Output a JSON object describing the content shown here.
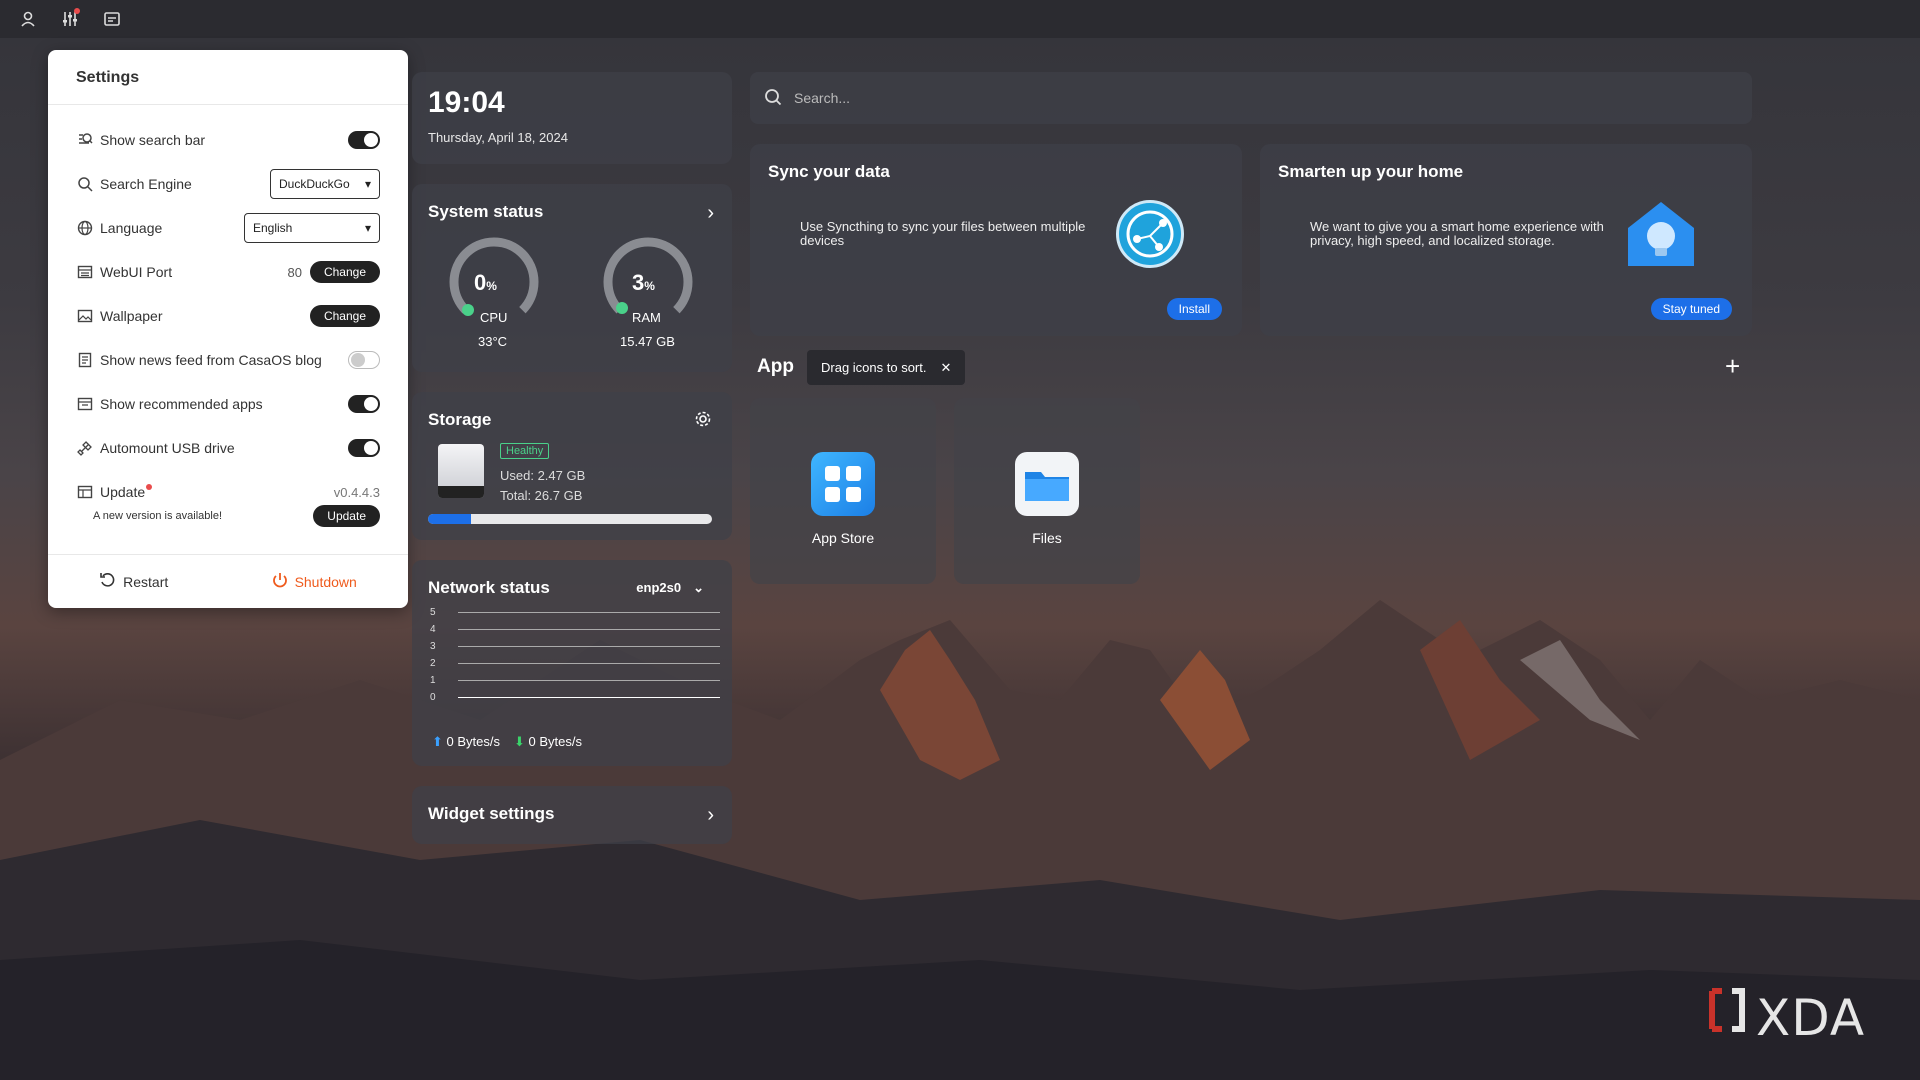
{
  "topbar": {
    "icons": [
      "user-icon",
      "sliders-icon",
      "widget-icon"
    ],
    "notification_dot_color": "#e94c4c"
  },
  "settings": {
    "title": "Settings",
    "show_search_bar": {
      "label": "Show search bar",
      "on": true
    },
    "search_engine": {
      "label": "Search Engine",
      "value": "DuckDuckGo"
    },
    "language": {
      "label": "Language",
      "value": "English"
    },
    "webui_port": {
      "label": "WebUI Port",
      "value": "80",
      "button": "Change"
    },
    "wallpaper": {
      "label": "Wallpaper",
      "button": "Change"
    },
    "news_feed": {
      "label": "Show news feed from CasaOS blog",
      "on": false
    },
    "recommended_apps": {
      "label": "Show recommended apps",
      "on": true
    },
    "automount": {
      "label": "Automount USB drive",
      "on": true
    },
    "update": {
      "label": "Update",
      "version": "v0.4.4.3",
      "note": "A new version is available!",
      "button": "Update"
    },
    "restart": "Restart",
    "shutdown": "Shutdown",
    "shutdown_color": "#ef5b1d"
  },
  "clock": {
    "time": "19:04",
    "date": "Thursday, April 18, 2024"
  },
  "system_status": {
    "title": "System status",
    "cpu": {
      "value": "0",
      "unit": "%",
      "label": "CPU",
      "sub": "33°C",
      "percent": 0
    },
    "ram": {
      "value": "3",
      "unit": "%",
      "label": "RAM",
      "sub": "15.47 GB",
      "percent": 3
    }
  },
  "storage": {
    "title": "Storage",
    "badge": "Healthy",
    "used": "Used: 2.47 GB",
    "total": "Total: 26.7 GB",
    "used_fraction": 0.15,
    "bar_color": "#1d6fe8"
  },
  "network": {
    "title": "Network status",
    "interface": "enp2s0",
    "y_ticks": [
      "5",
      "4",
      "3",
      "2",
      "1",
      "0"
    ],
    "upload": "0 Bytes/s",
    "download": "0 Bytes/s",
    "upload_color": "#3aa0ff",
    "download_color": "#3ad36a"
  },
  "widget_settings": {
    "title": "Widget settings"
  },
  "search": {
    "placeholder": "Search..."
  },
  "promos": [
    {
      "title": "Sync your data",
      "desc": "Use Syncthing to sync your files between multiple devices",
      "button": "Install",
      "icon": "syncthing-icon"
    },
    {
      "title": "Smarten up your home",
      "desc": "We want to give you a smart home experience with privacy, high speed, and localized storage.",
      "button": "Stay tuned",
      "icon": "smart-home-icon"
    }
  ],
  "apps_section": {
    "title": "App",
    "tooltip": "Drag icons to sort."
  },
  "apps": [
    {
      "name": "App Store",
      "icon": "app-store-icon"
    },
    {
      "name": "Files",
      "icon": "files-icon"
    }
  ],
  "watermark": "XDA"
}
